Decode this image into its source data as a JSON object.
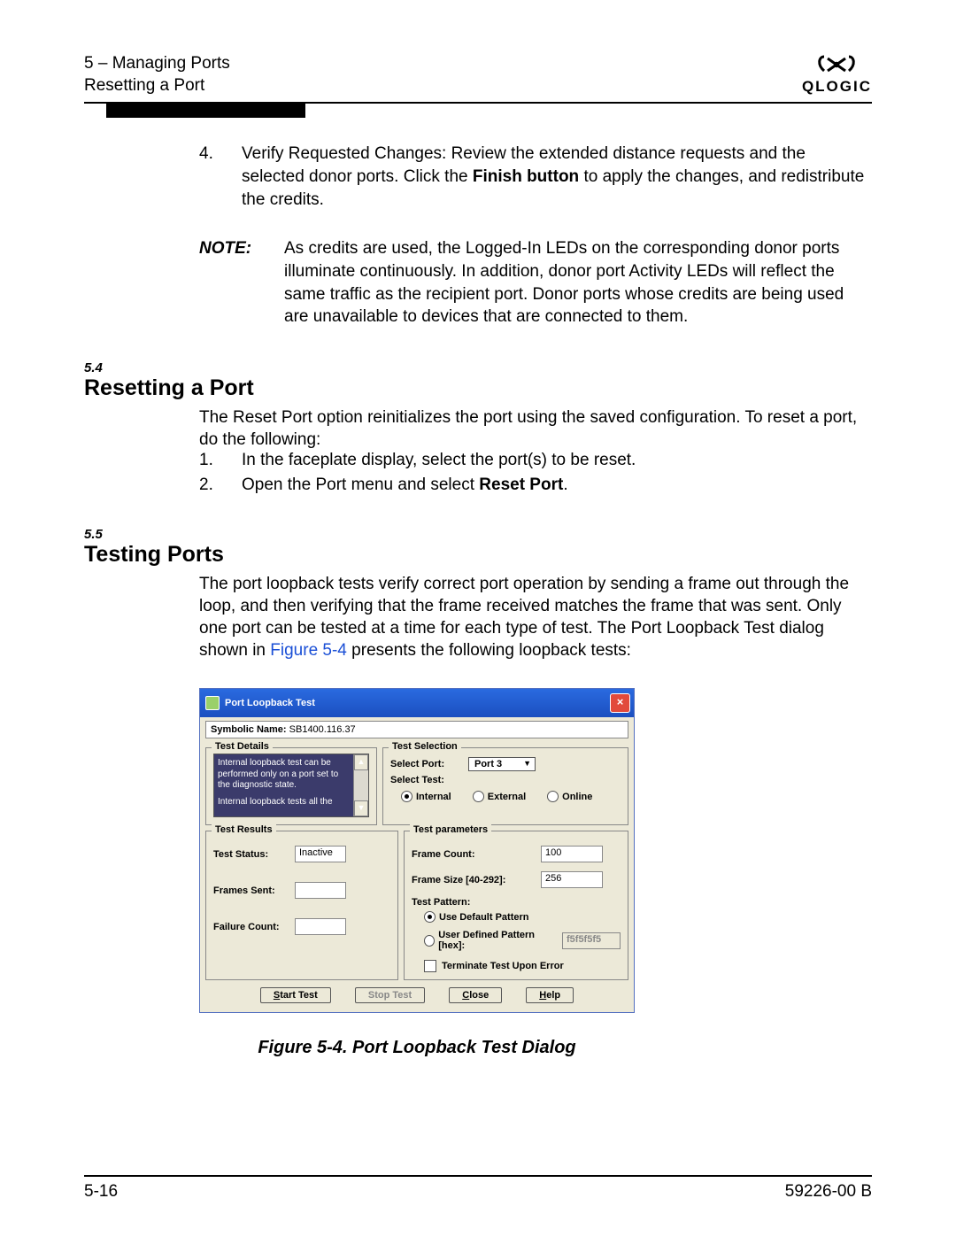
{
  "header": {
    "line1": "5 – Managing Ports",
    "line2": "Resetting a Port",
    "logo_text": "QLOGIC"
  },
  "step4": {
    "num": "4.",
    "text_before": "Verify Requested Changes: Review the extended distance requests and the selected donor ports. Click the ",
    "bold": "Finish button",
    "text_after": " to apply the changes, and redistribute the credits."
  },
  "note": {
    "label": "NOTE:",
    "text": "As credits are used, the Logged-In LEDs on the corresponding donor ports illuminate continuously. In addition, donor port Activity LEDs will reflect the same traffic as the recipient port. Donor ports whose credits are being used are unavailable to devices that are connected to them."
  },
  "sec54": {
    "num": "5.4",
    "head": "Resetting a Port",
    "para": "The Reset Port option reinitializes the port using the saved configuration. To reset a port, do the following:",
    "s1_num": "1.",
    "s1_text": "In the faceplate display, select the port(s) to be reset.",
    "s2_num": "2.",
    "s2_text_before": "Open the Port menu and select ",
    "s2_bold": "Reset Port",
    "s2_text_after": "."
  },
  "sec55": {
    "num": "5.5",
    "head": "Testing Ports",
    "para_before": "The port loopback tests verify correct port operation by sending a frame out through the loop, and then verifying that the frame received matches the frame that was sent. Only one port can be tested at a time for each type of test. The Port Loopback Test dialog shown in ",
    "fig_ref": "Figure 5-4",
    "para_after": " presents the following loopback tests:"
  },
  "dialog": {
    "title": "Port Loopback Test",
    "sym_label": "Symbolic Name:",
    "sym_value": " SB1400.116.37",
    "td_legend": "Test Details",
    "td_desc1": "Internal loopback test can be performed only on a port set to the diagnostic state.",
    "td_desc2": "Internal loopback tests all the",
    "ts_legend": "Test Selection",
    "ts_port_lbl": "Select Port:",
    "ts_port_val": "Port 3",
    "ts_test_lbl": "Select Test:",
    "ts_r1": "Internal",
    "ts_r2": "External",
    "ts_r3": "Online",
    "tr_legend": "Test Results",
    "tr_status_lbl": "Test Status:",
    "tr_status_val": "Inactive",
    "tr_frames_lbl": "Frames Sent:",
    "tr_fail_lbl": "Failure Count:",
    "tp_legend": "Test parameters",
    "tp_fc_lbl": "Frame Count:",
    "tp_fc_val": "100",
    "tp_fs_lbl": "Frame Size [40-292]:",
    "tp_fs_val": "256",
    "tp_pat_lbl": "Test Pattern:",
    "tp_r1": "Use Default Pattern",
    "tp_r2": "User Defined Pattern [hex]:",
    "tp_r2_val": "f5f5f5f5",
    "tp_term": "Terminate Test Upon Error",
    "btn_start": "Start Test",
    "btn_stop": "Stop Test",
    "btn_close": "Close",
    "btn_help": "Help"
  },
  "fig_caption": "Figure 5-4.  Port Loopback Test Dialog",
  "footer": {
    "left": "5-16",
    "right": "59226-00 B"
  }
}
